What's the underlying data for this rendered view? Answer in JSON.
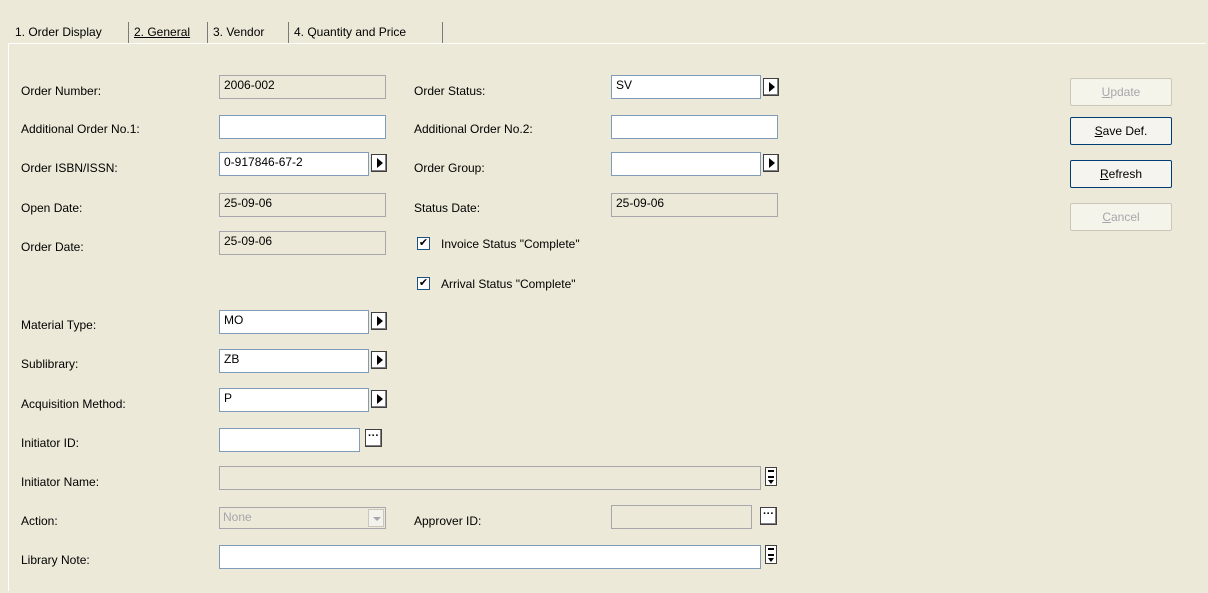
{
  "tabs": [
    {
      "label": "1. Order Display"
    },
    {
      "label": "2. General"
    },
    {
      "label": "3. Vendor"
    },
    {
      "label": "4. Quantity and Price"
    }
  ],
  "form": {
    "order_number": {
      "label": "Order Number:",
      "value": "2006-002"
    },
    "additional_order_1": {
      "label": "Additional Order No.1:",
      "value": ""
    },
    "order_isbn": {
      "label": "Order ISBN/ISSN:",
      "value": "0-917846-67-2"
    },
    "open_date": {
      "label": "Open Date:",
      "value": "25-09-06"
    },
    "order_date": {
      "label": "Order Date:",
      "value": "25-09-06"
    },
    "order_status": {
      "label": "Order Status:",
      "value": "SV"
    },
    "additional_order_2": {
      "label": "Additional Order No.2:",
      "value": ""
    },
    "order_group": {
      "label": "Order Group:",
      "value": ""
    },
    "status_date": {
      "label": "Status Date:",
      "value": "25-09-06"
    },
    "invoice_complete": {
      "label": "Invoice Status \"Complete\"",
      "checked": true
    },
    "arrival_complete": {
      "label": "Arrival Status \"Complete\"",
      "checked": true
    },
    "material_type": {
      "label": "Material Type:",
      "value": "MO"
    },
    "sublibrary": {
      "label": "Sublibrary:",
      "value": "ZB"
    },
    "acquisition_method": {
      "label": "Acquisition Method:",
      "value": "P"
    },
    "initiator_id": {
      "label": "Initiator ID:",
      "value": ""
    },
    "initiator_name": {
      "label": "Initiator Name:",
      "value": ""
    },
    "action": {
      "label": "Action:",
      "value": "None"
    },
    "approver_id": {
      "label": "Approver ID:",
      "value": ""
    },
    "library_note": {
      "label": "Library Note:",
      "value": ""
    }
  },
  "buttons": {
    "update": {
      "accel": "U",
      "rest": "pdate",
      "enabled": false
    },
    "save_def": {
      "accel": "S",
      "rest": "ave Def.",
      "enabled": true
    },
    "refresh": {
      "accel": "R",
      "rest": "efresh",
      "enabled": true
    },
    "cancel": {
      "accel": "C",
      "rest": "ancel",
      "enabled": false
    }
  },
  "check_glyph": "✔",
  "dots_glyph": "···"
}
